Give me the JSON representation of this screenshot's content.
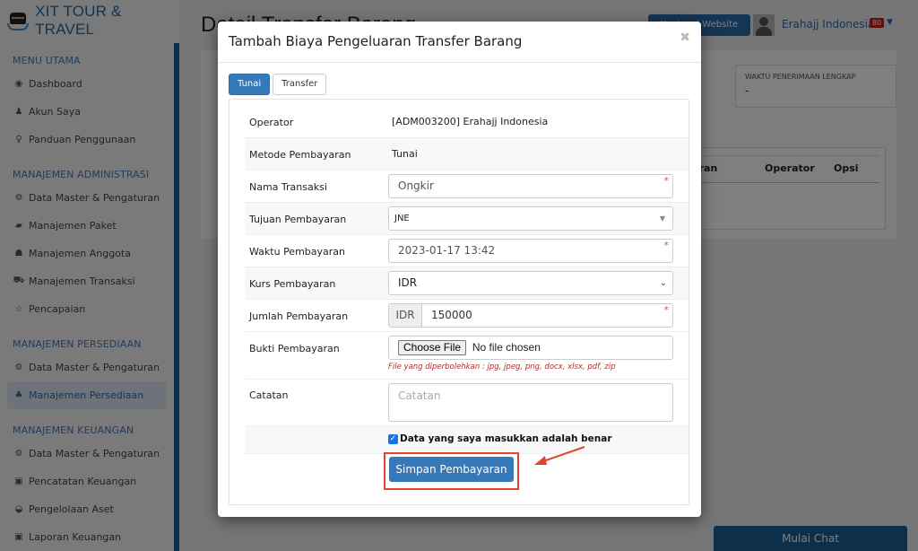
{
  "brand": {
    "name": "XIT TOUR & TRAVEL"
  },
  "sidebar": {
    "sections": [
      {
        "heading": "MENU UTAMA",
        "items": [
          {
            "icon": "globe-icon",
            "glyph": "◉",
            "label": "Dashboard"
          },
          {
            "icon": "user-icon",
            "glyph": "♟",
            "label": "Akun Saya"
          },
          {
            "icon": "lightbulb-icon",
            "glyph": "♀",
            "label": "Panduan Penggunaan"
          }
        ]
      },
      {
        "heading": "MANAJEMEN ADMINISTRASI",
        "items": [
          {
            "icon": "cogs-icon",
            "glyph": "⚙",
            "label": "Data Master & Pengaturan"
          },
          {
            "icon": "book-icon",
            "glyph": "▰",
            "label": "Manajemen Paket"
          },
          {
            "icon": "users-icon",
            "glyph": "☗",
            "label": "Manajemen Anggota"
          },
          {
            "icon": "cart-icon",
            "glyph": "⛟",
            "label": "Manajemen Transaksi"
          },
          {
            "icon": "star-icon",
            "glyph": "☆",
            "label": "Pencapaian"
          }
        ]
      },
      {
        "heading": "MANAJEMEN PERSEDIAAN",
        "items": [
          {
            "icon": "cogs-icon",
            "glyph": "⚙",
            "label": "Data Master & Pengaturan"
          },
          {
            "icon": "cubes-icon",
            "glyph": "♣",
            "label": "Manajemen Persediaan",
            "active": true
          }
        ]
      },
      {
        "heading": "MANAJEMEN KEUANGAN",
        "items": [
          {
            "icon": "cogs-icon",
            "glyph": "⚙",
            "label": "Data Master & Pengaturan"
          },
          {
            "icon": "money-icon",
            "glyph": "▣",
            "label": "Pencatatan Keuangan"
          },
          {
            "icon": "inbox-icon",
            "glyph": "◒",
            "label": "Pengelolaan Aset"
          },
          {
            "icon": "report-icon",
            "glyph": "▣",
            "label": "Laporan Keuangan"
          }
        ]
      }
    ]
  },
  "header": {
    "page_title": "Detail Transfer Barang",
    "website_button": "Kunjungi Website",
    "user_name": "Erahajj Indonesia",
    "notification_count": "80"
  },
  "background": {
    "info_label": "WAKTU PENERIMAAN LENGKAP",
    "info_value": "-",
    "table_headers": [
      "yaran",
      "Operator",
      "Opsi"
    ],
    "chat_button": "Mulai Chat"
  },
  "modal": {
    "title": "Tambah Biaya Pengeluaran Transfer Barang",
    "close_glyph": "✖",
    "tabs": [
      {
        "label": "Tunai",
        "active": true
      },
      {
        "label": "Transfer",
        "active": false
      }
    ],
    "fields": {
      "operator": {
        "label": "Operator",
        "value": "[ADM003200] Erahajj Indonesia"
      },
      "metode": {
        "label": "Metode Pembayaran",
        "value": "Tunai"
      },
      "nama": {
        "label": "Nama Transaksi",
        "value": "Ongkir",
        "required": "*"
      },
      "tujuan": {
        "label": "Tujuan Pembayaran",
        "value": "JNE"
      },
      "waktu": {
        "label": "Waktu Pembayaran",
        "value": "2023-01-17 13:42",
        "required": "*"
      },
      "kurs": {
        "label": "Kurs Pembayaran",
        "value": "IDR"
      },
      "jumlah": {
        "label": "Jumlah Pembayaran",
        "addon": "IDR",
        "value": "150000",
        "required": "*"
      },
      "bukti": {
        "label": "Bukti Pembayaran",
        "button": "Choose File",
        "status": "No file chosen",
        "help": "File yang diperbolehkan : jpg, jpeg, png, docx, xlsx, pdf, zip"
      },
      "catatan": {
        "label": "Catatan",
        "placeholder": "Catatan"
      }
    },
    "confirm_checkbox": {
      "label": "Data yang saya masukkan adalah benar",
      "checked": true
    },
    "save_button": "Simpan Pembayaran"
  },
  "colors": {
    "primary": "#3579b8",
    "brand": "#27679d",
    "highlight": "#e0452c",
    "badge": "#c0201a"
  }
}
